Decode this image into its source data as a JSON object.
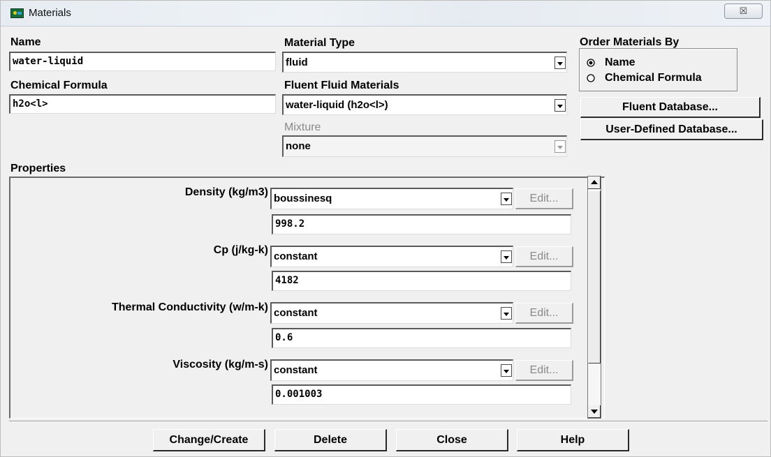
{
  "window": {
    "title": "Materials",
    "close_glyph": "☒",
    "close_icon": "close-icon"
  },
  "name": {
    "label": "Name",
    "value": "water-liquid"
  },
  "chemical_formula": {
    "label": "Chemical Formula",
    "value": "h2o<l>"
  },
  "material_type": {
    "label": "Material Type",
    "value": "fluid"
  },
  "fluent_fluid_materials": {
    "label": "Fluent Fluid Materials",
    "value": "water-liquid (h2o<l>)"
  },
  "mixture": {
    "label": "Mixture",
    "value": "none",
    "enabled": false
  },
  "order_by": {
    "label": "Order Materials By",
    "options": [
      {
        "label": "Name",
        "selected": true
      },
      {
        "label": "Chemical Formula",
        "selected": false
      }
    ]
  },
  "db_buttons": {
    "fluent_database": "Fluent Database...",
    "user_defined_database": "User-Defined Database..."
  },
  "properties": {
    "label": "Properties",
    "items": [
      {
        "label": "Density (kg/m3)",
        "method": "boussinesq",
        "edit": "Edit...",
        "value": "998.2"
      },
      {
        "label": "Cp (j/kg-k)",
        "method": "constant",
        "edit": "Edit...",
        "value": "4182"
      },
      {
        "label": "Thermal Conductivity (w/m-k)",
        "method": "constant",
        "edit": "Edit...",
        "value": "0.6"
      },
      {
        "label": "Viscosity (kg/m-s)",
        "method": "constant",
        "edit": "Edit...",
        "value": "0.001003"
      }
    ]
  },
  "actions": {
    "change_create": "Change/Create",
    "delete": "Delete",
    "close": "Close",
    "help": "Help"
  }
}
